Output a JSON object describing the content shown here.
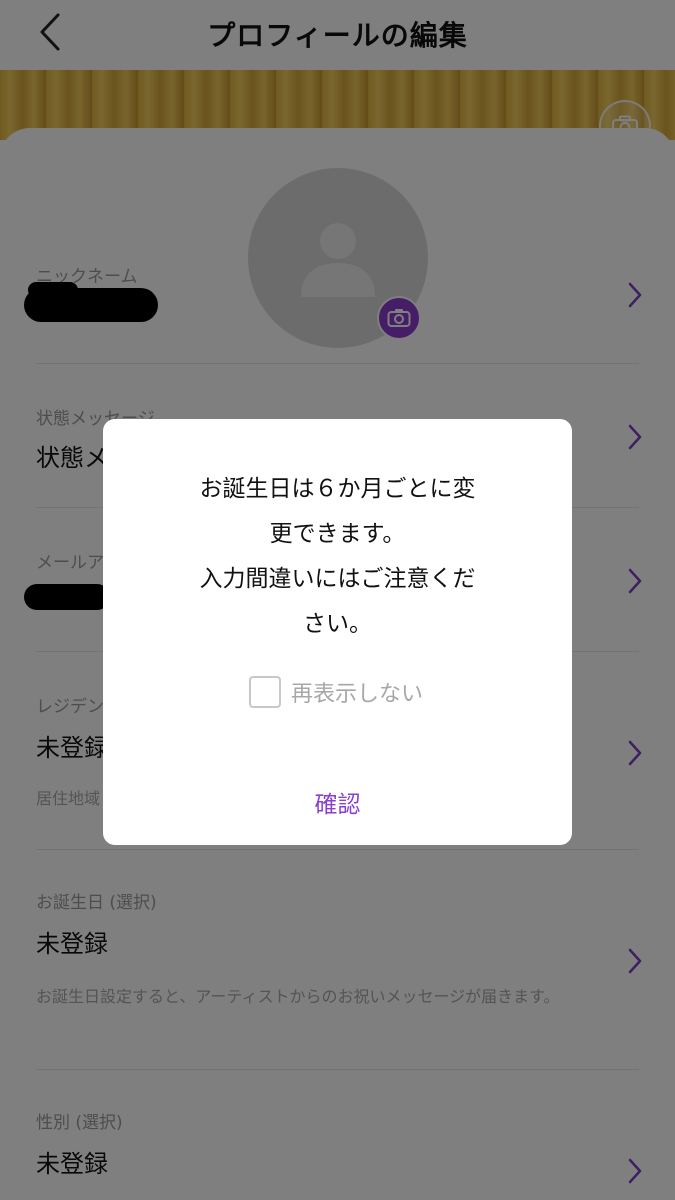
{
  "header": {
    "title": "プロフィールの編集"
  },
  "profile": {
    "rows": [
      {
        "label": "ニックネーム",
        "value": ""
      },
      {
        "label": "状態メッセージ",
        "value": "状態メ"
      },
      {
        "label": "メールア",
        "value": ""
      },
      {
        "label": "レジデン",
        "value": "未登録",
        "note": "居住地域"
      },
      {
        "label": "お誕生日 (選択)",
        "value": "未登録",
        "note": "お誕生日設定すると、アーティストからのお祝いメッセージが届きます。"
      },
      {
        "label": "性別 (選択)",
        "value": "未登録"
      }
    ]
  },
  "dialog": {
    "message_lines": [
      "お誕生日は６か月ごとに変",
      "更できます。",
      "入力間違いにはご注意くだ",
      "さい。"
    ],
    "checkbox_label": "再表示しない",
    "checkbox_checked": false,
    "confirm_label": "確認"
  },
  "colors": {
    "accent": "#8a3fd0",
    "chevron": "#7b3fc4"
  }
}
